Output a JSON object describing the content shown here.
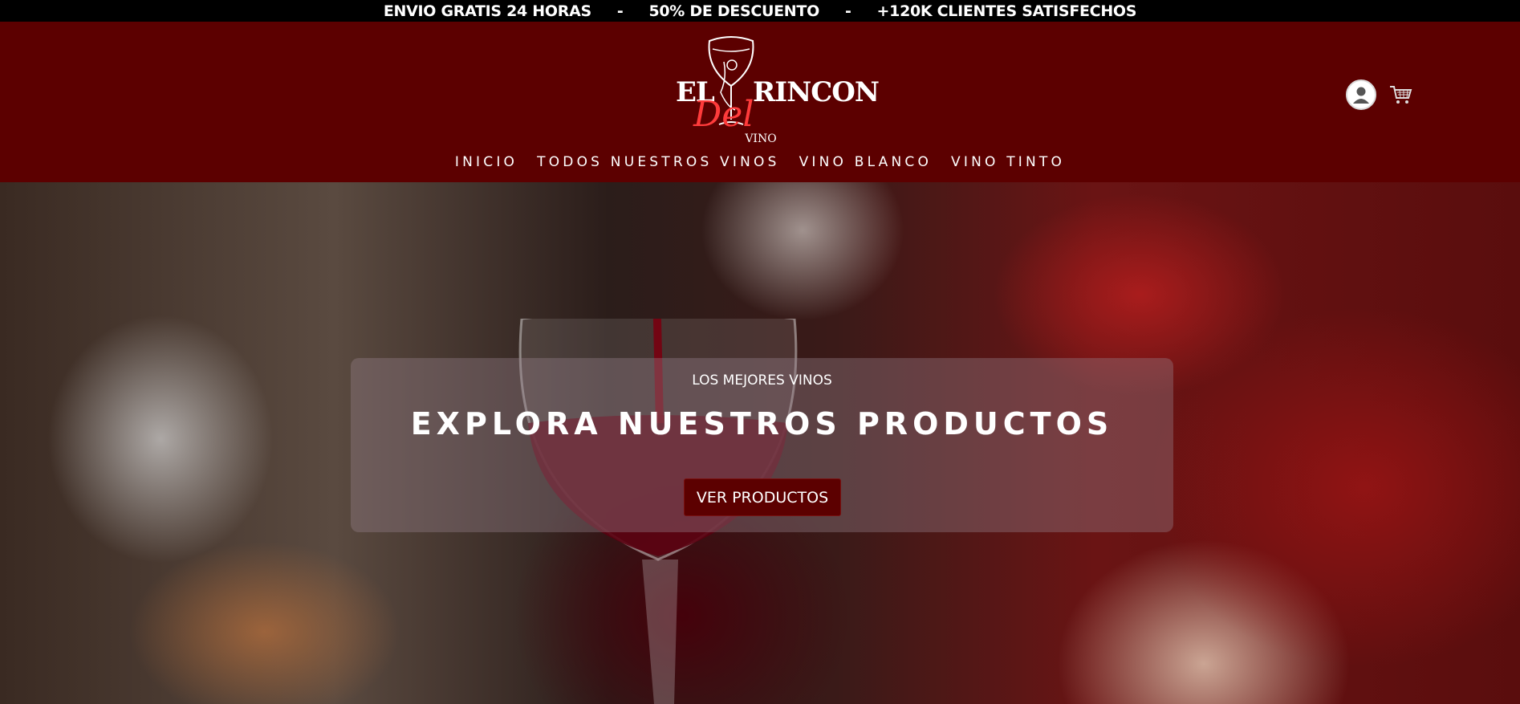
{
  "announcement": {
    "items": [
      "ENVIO GRATIS 24 HORAS",
      "50% DE DESCUENTO",
      "+120K CLIENTES SATISFECHOS"
    ],
    "separator": "-"
  },
  "logo": {
    "el": "EL",
    "rincon": "RINCON",
    "del": "Del",
    "vino": "VINO"
  },
  "header_icons": {
    "account": "user-icon",
    "cart": "cart-icon"
  },
  "nav": {
    "items": [
      "INICIO",
      "TODOS NUESTROS VINOS",
      "VINO BLANCO",
      "VINO TINTO"
    ]
  },
  "hero": {
    "kicker": "LOS MEJORES VINOS",
    "title": "EXPLORA NUESTROS PRODUCTOS",
    "cta_label": "VER PRODUCTOS"
  },
  "colors": {
    "header_bg": "#5c0000",
    "announce_bg": "#000000",
    "logo_accent": "#ff3b3b",
    "cta_bg": "#5c0000"
  }
}
